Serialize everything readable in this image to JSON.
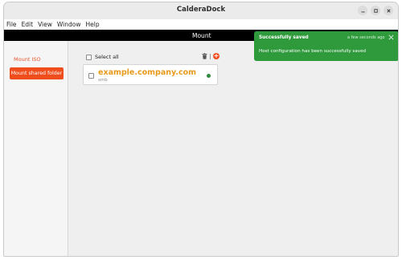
{
  "window": {
    "title": "CalderaDock",
    "controls": [
      "minimize-icon",
      "maximize-icon",
      "close-icon"
    ]
  },
  "menubar": {
    "items": [
      "File",
      "Edit",
      "View",
      "Window",
      "Help"
    ]
  },
  "header": {
    "title": "Mount"
  },
  "sidebar": {
    "mount_iso": "Mount ISO",
    "mount_shared_folder": "Mount shared folder"
  },
  "main": {
    "select_all": "Select all",
    "items": [
      {
        "host": "example.company.com",
        "type": "smb",
        "status_color": "#2e8b3d"
      }
    ]
  },
  "toast": {
    "title": "Successfully saved",
    "time": "a few seconds ago",
    "message": "Host configuration has been successfully saved",
    "color": "#2e9a3c"
  },
  "colors": {
    "accent": "#f04d1c",
    "host_text": "#e89a1a"
  }
}
